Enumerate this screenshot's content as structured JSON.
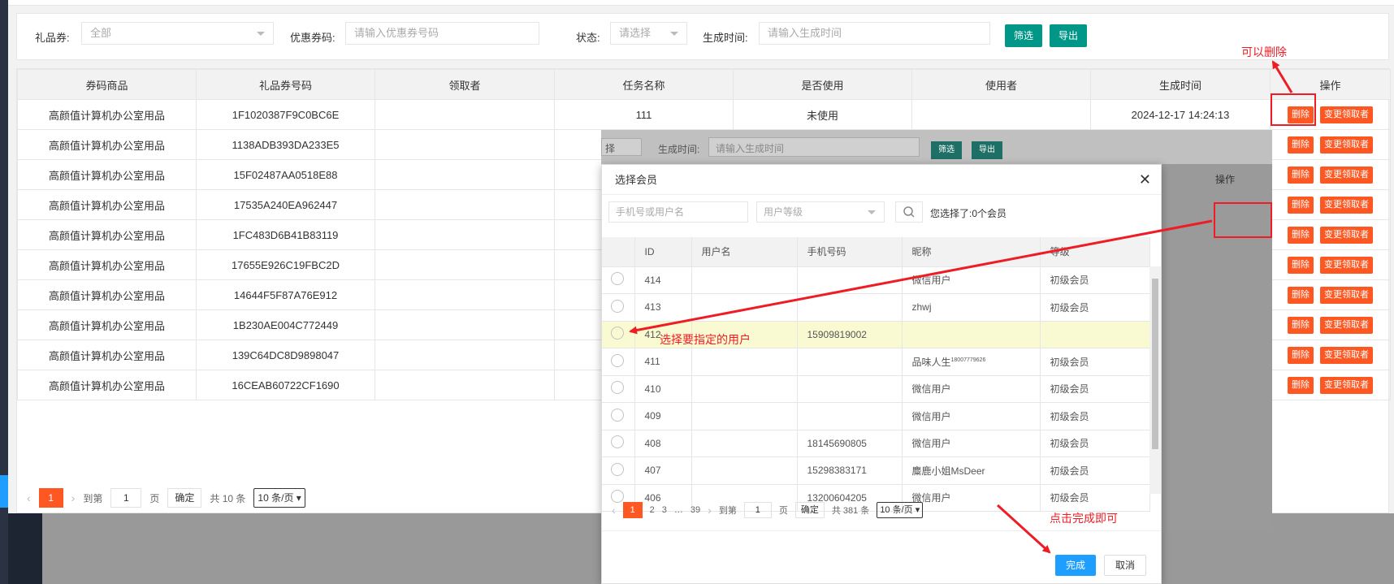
{
  "filter": {
    "gift_label": "礼品券:",
    "gift_value": "全部",
    "coupon_label": "优惠券码:",
    "coupon_placeholder": "请输入优惠券号码",
    "status_label": "状态:",
    "status_placeholder": "请选择",
    "time_label": "生成时间:",
    "time_placeholder": "请输入生成时间",
    "filter_btn": "筛选",
    "export_btn": "导出"
  },
  "table": {
    "headers": [
      "券码商品",
      "礼品券号码",
      "领取者",
      "任务名称",
      "是否使用",
      "使用者",
      "生成时间",
      "操作"
    ],
    "rows": [
      {
        "product": "高颜值计算机办公室用品",
        "code": "1F1020387F9C0BC6E",
        "receiver": "",
        "task": "111",
        "used": "未使用",
        "user": "",
        "time": "2024-12-17 14:24:13"
      },
      {
        "product": "高颜值计算机办公室用品",
        "code": "1138ADB393DA233E5",
        "receiver": "",
        "task": "",
        "used": "",
        "user": "",
        "time": ""
      },
      {
        "product": "高颜值计算机办公室用品",
        "code": "15F02487AA0518E88",
        "receiver": "",
        "task": "",
        "used": "",
        "user": "",
        "time": ""
      },
      {
        "product": "高颜值计算机办公室用品",
        "code": "17535A240EA962447",
        "receiver": "",
        "task": "",
        "used": "",
        "user": "",
        "time": ""
      },
      {
        "product": "高颜值计算机办公室用品",
        "code": "1FC483D6B41B83119",
        "receiver": "",
        "task": "",
        "used": "",
        "user": "",
        "time": ""
      },
      {
        "product": "高颜值计算机办公室用品",
        "code": "17655E926C19FBC2D",
        "receiver": "",
        "task": "",
        "used": "",
        "user": "",
        "time": ""
      },
      {
        "product": "高颜值计算机办公室用品",
        "code": "14644F5F87A76E912",
        "receiver": "",
        "task": "",
        "used": "",
        "user": "",
        "time": ""
      },
      {
        "product": "高颜值计算机办公室用品",
        "code": "1B230AE004C772449",
        "receiver": "",
        "task": "",
        "used": "",
        "user": "",
        "time": ""
      },
      {
        "product": "高颜值计算机办公室用品",
        "code": "139C64DC8D9898047",
        "receiver": "",
        "task": "",
        "used": "",
        "user": "",
        "time": ""
      },
      {
        "product": "高颜值计算机办公室用品",
        "code": "16CEAB60722CF1690",
        "receiver": "",
        "task": "",
        "used": "",
        "user": "",
        "time": ""
      }
    ],
    "delete_btn": "删除",
    "change_btn": "变更领取者"
  },
  "pager": {
    "current": "1",
    "goto_label": "到第",
    "goto_value": "1",
    "page_unit": "页",
    "confirm": "确定",
    "total": "共 10 条",
    "per_page": "10 条/页"
  },
  "overlay": {
    "select_fragment": "择",
    "time_label": "生成时间:",
    "time_placeholder": "请输入生成时间",
    "filter_btn": "筛选",
    "export_btn": "导出",
    "op_header": "操作",
    "delete_btn": "删除",
    "change_btn": "变更领取者"
  },
  "modal": {
    "title": "选择会员",
    "search_placeholder": "手机号或用户名",
    "level_placeholder": "用户等级",
    "selected_text": "您选择了:0个会员",
    "headers": [
      "",
      "ID",
      "用户名",
      "手机号码",
      "昵称",
      "等级"
    ],
    "rows": [
      {
        "id": "414",
        "username": "",
        "phone": "",
        "nickname": "微信用户",
        "level": "初级会员"
      },
      {
        "id": "413",
        "username": "",
        "phone": "",
        "nickname": "zhwj",
        "level": "初级会员"
      },
      {
        "id": "412",
        "username": "",
        "phone": "15909819002",
        "nickname": "",
        "level": ""
      },
      {
        "id": "411",
        "username": "",
        "phone": "",
        "nickname": "品味人生",
        "nickname_sup": "18007779626",
        "level": "初级会员"
      },
      {
        "id": "410",
        "username": "",
        "phone": "",
        "nickname": "微信用户",
        "level": "初级会员"
      },
      {
        "id": "409",
        "username": "",
        "phone": "",
        "nickname": "微信用户",
        "level": "初级会员"
      },
      {
        "id": "408",
        "username": "",
        "phone": "18145690805",
        "nickname": "微信用户",
        "level": "初级会员"
      },
      {
        "id": "407",
        "username": "",
        "phone": "15298383171",
        "nickname": "麋鹿小姐MsDeer",
        "level": "初级会员"
      },
      {
        "id": "406",
        "username": "",
        "phone": "13200604205",
        "nickname": "微信用户",
        "level": "初级会员"
      }
    ],
    "pager": {
      "p1": "1",
      "p2": "2",
      "p3": "3",
      "ellipsis": "…",
      "last": "39",
      "goto_label": "到第",
      "goto_value": "1",
      "page_unit": "页",
      "confirm": "确定",
      "total": "共 381 条",
      "per_page": "10 条/页"
    },
    "done_btn": "完成",
    "cancel_btn": "取消"
  },
  "annotations": {
    "can_delete": "可以删除",
    "select_user": "选择要指定的用户",
    "click_done": "点击完成即可",
    "color": "#ee1c25"
  }
}
